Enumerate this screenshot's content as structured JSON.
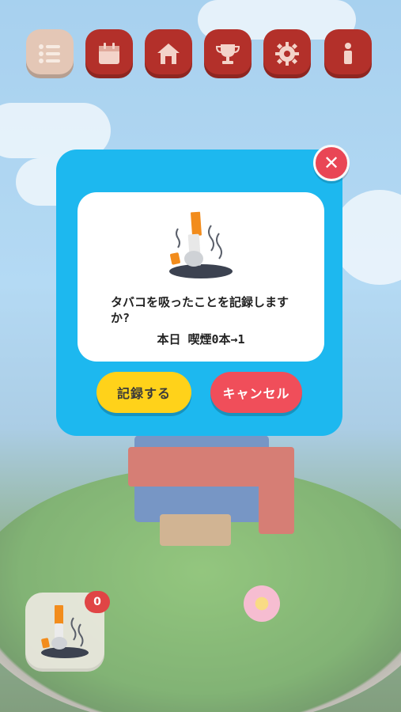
{
  "toolbar": {
    "items": [
      {
        "name": "menu",
        "icon": "list-icon"
      },
      {
        "name": "calendar",
        "icon": "calendar-icon"
      },
      {
        "name": "home",
        "icon": "home-icon"
      },
      {
        "name": "trophy",
        "icon": "trophy-icon"
      },
      {
        "name": "settings",
        "icon": "gear-icon"
      },
      {
        "name": "info",
        "icon": "info-icon"
      }
    ]
  },
  "dialog": {
    "close_icon": "close-icon",
    "illustration": "cigarette-in-ashtray-icon",
    "message": "タバコを吸ったことを記録しますか?",
    "count_text": "本日 喫煙0本→1",
    "record_label": "記録する",
    "cancel_label": "キャンセル"
  },
  "quick_record": {
    "icon": "cigarette-in-ashtray-icon",
    "badge": "0"
  },
  "colors": {
    "dialog_bg": "#1db8ef",
    "record_button": "#ffd21a",
    "cancel_button": "#f04e5a",
    "close_button": "#e94655",
    "toolbar_button": "#b3302a"
  }
}
